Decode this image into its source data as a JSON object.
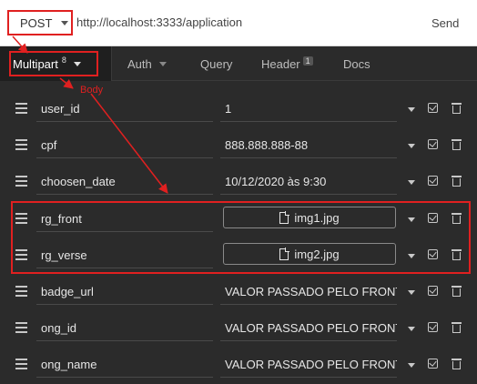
{
  "request": {
    "method": "POST",
    "url": "http://localhost:3333/application",
    "send_label": "Send"
  },
  "tabs": {
    "multipart": {
      "label": "Multipart",
      "count": "8"
    },
    "auth": {
      "label": "Auth"
    },
    "query": {
      "label": "Query"
    },
    "header": {
      "label": "Header",
      "count": "1"
    },
    "docs": {
      "label": "Docs"
    }
  },
  "annotation": {
    "label": "Body",
    "color": "#e02020"
  },
  "fields": [
    {
      "name": "user_id",
      "value": "1",
      "type": "text"
    },
    {
      "name": "cpf",
      "value": "888.888.888-88",
      "type": "text"
    },
    {
      "name": "choosen_date",
      "value": "10/12/2020 às 9:30",
      "type": "text"
    },
    {
      "name": "rg_front",
      "value": "img1.jpg",
      "type": "file"
    },
    {
      "name": "rg_verse",
      "value": "img2.jpg",
      "type": "file"
    },
    {
      "name": "badge_url",
      "value": "VALOR PASSADO PELO FRONT",
      "type": "text"
    },
    {
      "name": "ong_id",
      "value": "VALOR PASSADO PELO FRONT",
      "type": "text"
    },
    {
      "name": "ong_name",
      "value": "VALOR PASSADO PELO FRONT",
      "type": "text"
    }
  ],
  "icons": {
    "drag": "drag-handle-icon",
    "caret": "chevron-down-icon",
    "check": "checkbox-icon",
    "trash": "trash-icon",
    "file": "file-icon"
  }
}
